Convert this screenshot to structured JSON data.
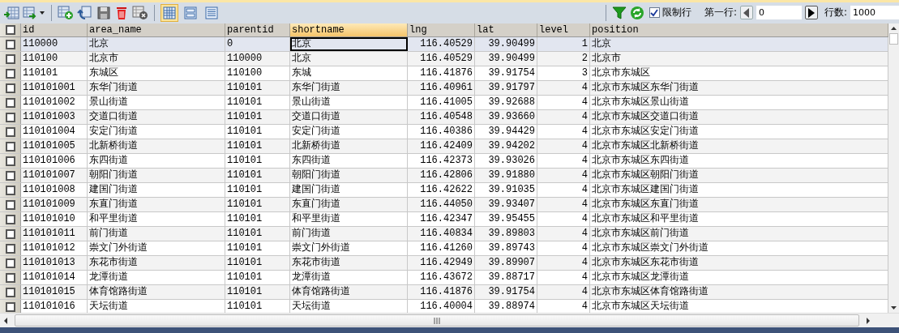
{
  "toolbar": {
    "view_modes": [
      {
        "selected": true
      },
      {
        "selected": false
      },
      {
        "selected": false
      }
    ],
    "limit_rows": {
      "label": "限制行",
      "checked": true
    },
    "first_row": {
      "label": "第一行:",
      "value": "0"
    },
    "row_count": {
      "label": "行数:",
      "value": "1000"
    }
  },
  "table": {
    "columns": [
      {
        "name": "id",
        "kind": "text",
        "selected": false
      },
      {
        "name": "area_name",
        "kind": "text",
        "selected": false
      },
      {
        "name": "parentid",
        "kind": "text",
        "selected": false
      },
      {
        "name": "shortname",
        "kind": "text",
        "selected": true
      },
      {
        "name": "lng",
        "kind": "number",
        "selected": false
      },
      {
        "name": "lat",
        "kind": "number",
        "selected": false
      },
      {
        "name": "level",
        "kind": "number",
        "selected": false
      },
      {
        "name": "position",
        "kind": "text",
        "selected": false
      }
    ],
    "all_checked": false,
    "rows": [
      {
        "selected": true,
        "checked": false,
        "cells": [
          "110000",
          "北京",
          "0",
          "北京",
          "116.40529",
          "39.90499",
          "1",
          "北京"
        ]
      },
      {
        "selected": false,
        "checked": false,
        "cells": [
          "110100",
          "北京市",
          "110000",
          "北京",
          "116.40529",
          "39.90499",
          "2",
          "北京市"
        ]
      },
      {
        "selected": false,
        "checked": false,
        "cells": [
          "110101",
          "东城区",
          "110100",
          "东城",
          "116.41876",
          "39.91754",
          "3",
          "北京市东城区"
        ]
      },
      {
        "selected": false,
        "checked": false,
        "cells": [
          "110101001",
          "东华门街道",
          "110101",
          "东华门街道",
          "116.40961",
          "39.91797",
          "4",
          "北京市东城区东华门街道"
        ]
      },
      {
        "selected": false,
        "checked": false,
        "cells": [
          "110101002",
          "景山街道",
          "110101",
          "景山街道",
          "116.41005",
          "39.92688",
          "4",
          "北京市东城区景山街道"
        ]
      },
      {
        "selected": false,
        "checked": false,
        "cells": [
          "110101003",
          "交道口街道",
          "110101",
          "交道口街道",
          "116.40548",
          "39.93660",
          "4",
          "北京市东城区交道口街道"
        ]
      },
      {
        "selected": false,
        "checked": false,
        "cells": [
          "110101004",
          "安定门街道",
          "110101",
          "安定门街道",
          "116.40386",
          "39.94429",
          "4",
          "北京市东城区安定门街道"
        ]
      },
      {
        "selected": false,
        "checked": false,
        "cells": [
          "110101005",
          "北新桥街道",
          "110101",
          "北新桥街道",
          "116.42409",
          "39.94202",
          "4",
          "北京市东城区北新桥街道"
        ]
      },
      {
        "selected": false,
        "checked": false,
        "cells": [
          "110101006",
          "东四街道",
          "110101",
          "东四街道",
          "116.42373",
          "39.93026",
          "4",
          "北京市东城区东四街道"
        ]
      },
      {
        "selected": false,
        "checked": false,
        "cells": [
          "110101007",
          "朝阳门街道",
          "110101",
          "朝阳门街道",
          "116.42806",
          "39.91880",
          "4",
          "北京市东城区朝阳门街道"
        ]
      },
      {
        "selected": false,
        "checked": false,
        "cells": [
          "110101008",
          "建国门街道",
          "110101",
          "建国门街道",
          "116.42622",
          "39.91035",
          "4",
          "北京市东城区建国门街道"
        ]
      },
      {
        "selected": false,
        "checked": false,
        "cells": [
          "110101009",
          "东直门街道",
          "110101",
          "东直门街道",
          "116.44050",
          "39.93407",
          "4",
          "北京市东城区东直门街道"
        ]
      },
      {
        "selected": false,
        "checked": false,
        "cells": [
          "110101010",
          "和平里街道",
          "110101",
          "和平里街道",
          "116.42347",
          "39.95455",
          "4",
          "北京市东城区和平里街道"
        ]
      },
      {
        "selected": false,
        "checked": false,
        "cells": [
          "110101011",
          "前门街道",
          "110101",
          "前门街道",
          "116.40834",
          "39.89803",
          "4",
          "北京市东城区前门街道"
        ]
      },
      {
        "selected": false,
        "checked": false,
        "cells": [
          "110101012",
          "崇文门外街道",
          "110101",
          "崇文门外街道",
          "116.41260",
          "39.89743",
          "4",
          "北京市东城区崇文门外街道"
        ]
      },
      {
        "selected": false,
        "checked": false,
        "cells": [
          "110101013",
          "东花市街道",
          "110101",
          "东花市街道",
          "116.42949",
          "39.89907",
          "4",
          "北京市东城区东花市街道"
        ]
      },
      {
        "selected": false,
        "checked": false,
        "cells": [
          "110101014",
          "龙潭街道",
          "110101",
          "龙潭街道",
          "116.43672",
          "39.88717",
          "4",
          "北京市东城区龙潭街道"
        ]
      },
      {
        "selected": false,
        "checked": false,
        "cells": [
          "110101015",
          "体育馆路街道",
          "110101",
          "体育馆路街道",
          "116.41876",
          "39.91754",
          "4",
          "北京市东城区体育馆路街道"
        ]
      },
      {
        "selected": false,
        "checked": false,
        "cells": [
          "110101016",
          "天坛街道",
          "110101",
          "天坛街道",
          "116.40004",
          "39.88974",
          "4",
          "北京市东城区天坛街道"
        ]
      }
    ]
  }
}
